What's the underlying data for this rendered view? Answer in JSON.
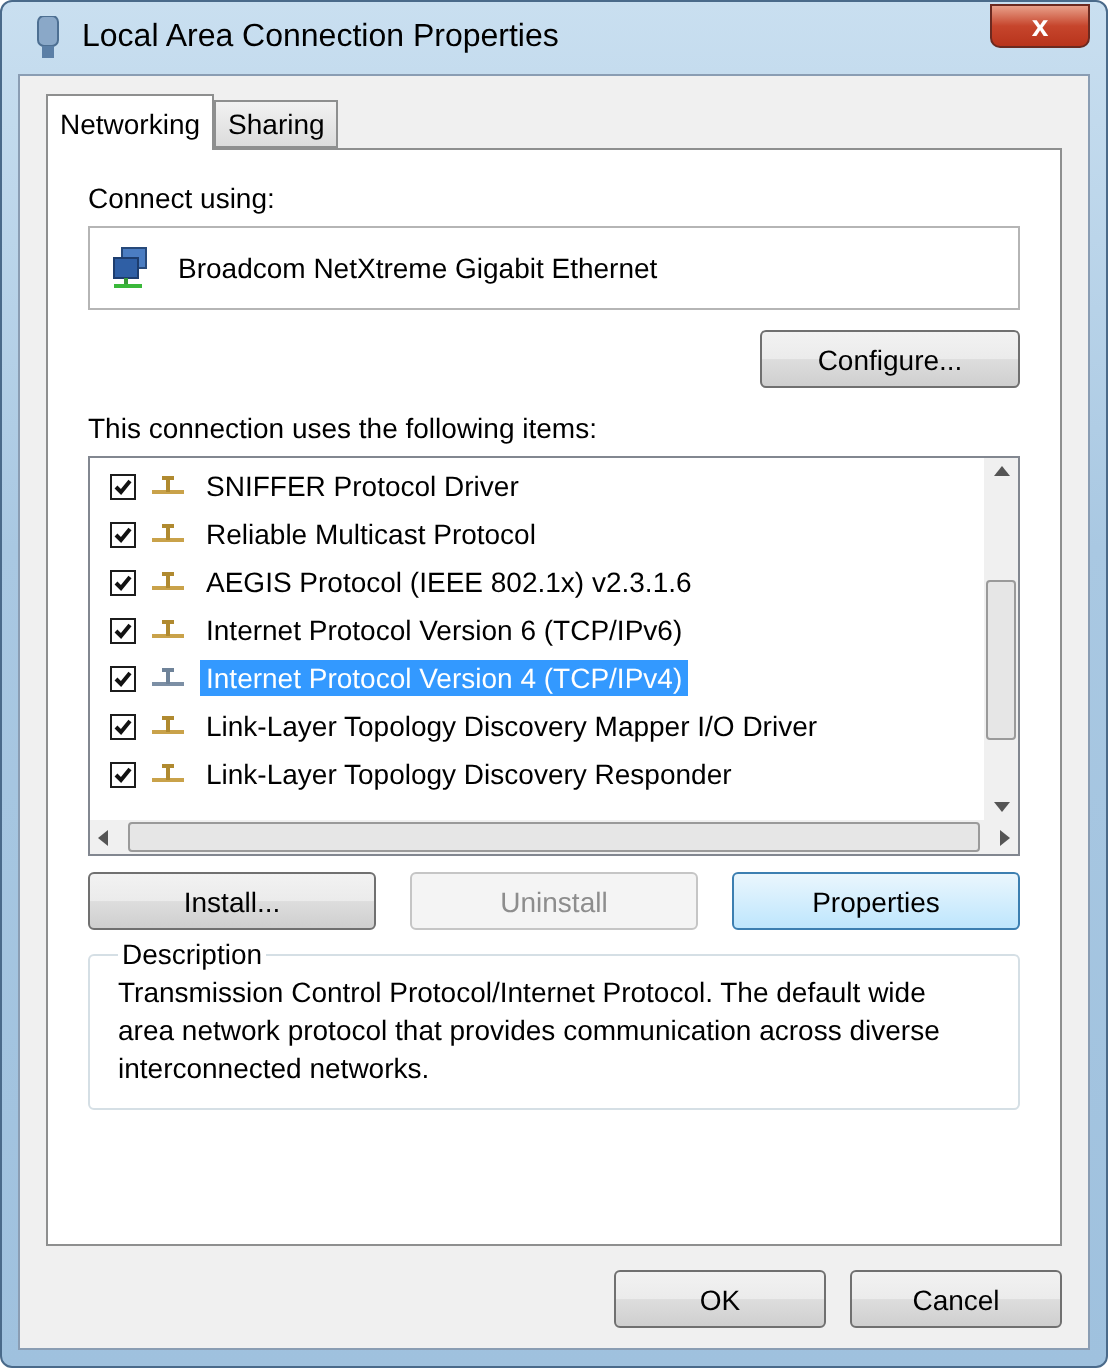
{
  "window": {
    "title": "Local Area Connection Properties",
    "close": "x"
  },
  "tabs": [
    {
      "label": "Networking",
      "selected": true
    },
    {
      "label": "Sharing",
      "selected": false
    }
  ],
  "connect_using": {
    "label": "Connect using:",
    "adapter": "Broadcom NetXtreme Gigabit Ethernet",
    "configure": "Configure..."
  },
  "items_label": "This connection uses the following items:",
  "items": [
    {
      "label": "SNIFFER Protocol Driver",
      "checked": true,
      "selected": false
    },
    {
      "label": "Reliable Multicast Protocol",
      "checked": true,
      "selected": false
    },
    {
      "label": "AEGIS Protocol (IEEE 802.1x) v2.3.1.6",
      "checked": true,
      "selected": false
    },
    {
      "label": "Internet Protocol Version 6 (TCP/IPv6)",
      "checked": true,
      "selected": false
    },
    {
      "label": "Internet Protocol Version 4 (TCP/IPv4)",
      "checked": true,
      "selected": true
    },
    {
      "label": "Link-Layer Topology Discovery Mapper I/O Driver",
      "checked": true,
      "selected": false
    },
    {
      "label": "Link-Layer Topology Discovery Responder",
      "checked": true,
      "selected": false
    }
  ],
  "item_buttons": [
    {
      "label": "Install...",
      "disabled": false,
      "default": false
    },
    {
      "label": "Uninstall",
      "disabled": true,
      "default": false
    },
    {
      "label": "Properties",
      "disabled": false,
      "default": true
    }
  ],
  "description": {
    "title": "Description",
    "text": "Transmission Control Protocol/Internet Protocol. The default wide area network protocol that provides communication across diverse interconnected networks."
  },
  "buttons": [
    "OK",
    "Cancel"
  ]
}
